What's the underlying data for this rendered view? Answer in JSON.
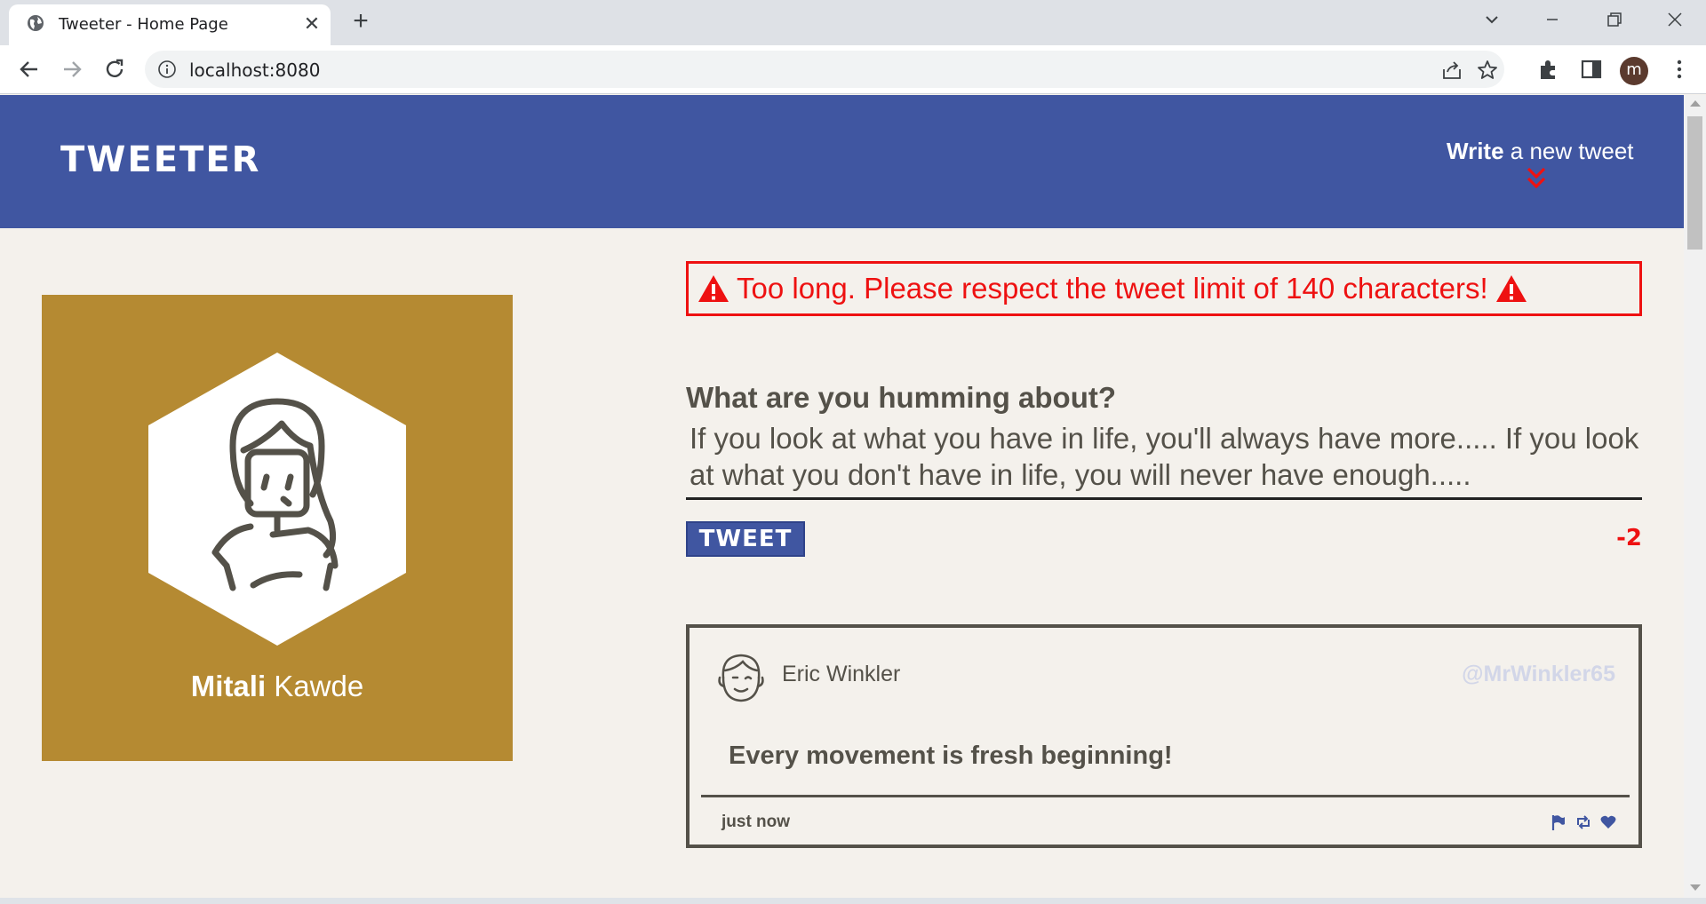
{
  "browser": {
    "tab_title": "Tweeter - Home Page",
    "url": "localhost:8080",
    "profile_initial": "m"
  },
  "nav": {
    "logo": "TWEETER",
    "write_bold": "Write",
    "write_rest": " a new tweet"
  },
  "profile": {
    "first_name": "Mitali",
    "last_name": " Kawde",
    "card_color": "#b58a32"
  },
  "error": {
    "message": "Too long. Please respect the tweet limit of 140 characters!",
    "color": "#ee1111"
  },
  "compose": {
    "label": "What are you humming about?",
    "text": "If you look at what you have in life, you'll always have more..... If you look at what you don't have in life, you will never have enough.....",
    "button_label": "TWEET",
    "counter": "-2"
  },
  "tweets": [
    {
      "name": "Eric Winkler",
      "handle": "@MrWinkler65",
      "content": "Every movement is fresh beginning!",
      "time": "just now",
      "actions": [
        "flag-icon",
        "retweet-icon",
        "heart-icon"
      ]
    }
  ],
  "colors": {
    "nav_bg": "#4056a1",
    "page_bg": "#f4f1ec",
    "text": "#545149"
  }
}
